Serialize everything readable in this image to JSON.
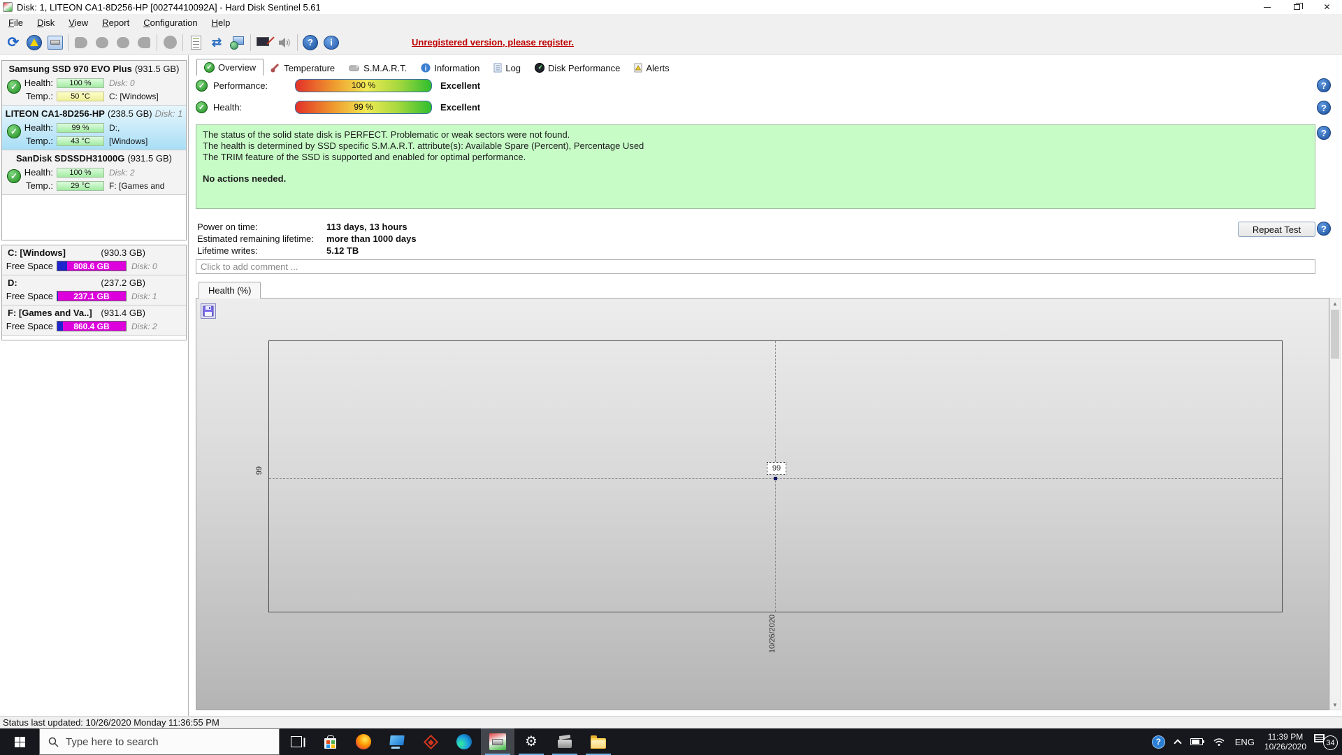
{
  "window": {
    "title": "Disk: 1, LITEON CA1-8D256-HP [00274410092A]  -  Hard Disk Sentinel 5.61"
  },
  "menu": [
    "File",
    "Disk",
    "View",
    "Report",
    "Configuration",
    "Help"
  ],
  "toolbar": {
    "register": "Unregistered version, please register."
  },
  "sidebar": {
    "disks": [
      {
        "name": "Samsung SSD 970 EVO Plus",
        "size": "(931.5 GB)",
        "extra": "",
        "health_label": "Health:",
        "health": "100 %",
        "health_right": "Disk: 0",
        "temp_label": "Temp.:",
        "temp": "50 °C",
        "temp_right": "C: [Windows]"
      },
      {
        "name": "LITEON CA1-8D256-HP",
        "size": "(238.5 GB)",
        "extra": "Disk: 1",
        "health_label": "Health:",
        "health": "99 %",
        "health_right": "D:,",
        "temp_label": "Temp.:",
        "temp": "43 °C",
        "temp_right": "[Windows]"
      },
      {
        "name": "SanDisk SDSSDH31000G",
        "size": "(931.5 GB)",
        "extra": "",
        "health_label": "Health:",
        "health": "100 %",
        "health_right": "Disk: 2",
        "temp_label": "Temp.:",
        "temp": "29 °C",
        "temp_right": "F: [Games and"
      }
    ],
    "partitions": [
      {
        "name": "C: [Windows]",
        "size": "(930.3 GB)",
        "free_label": "Free Space",
        "free": "808.6 GB",
        "right": "Disk: 0",
        "used_pct": "14%"
      },
      {
        "name": "D:",
        "size": "(237.2 GB)",
        "free_label": "Free Space",
        "free": "237.1 GB",
        "right": "Disk: 1",
        "used_pct": "1%"
      },
      {
        "name": "F: [Games and Va..]",
        "size": "(931.4 GB)",
        "free_label": "Free Space",
        "free": "860.4 GB",
        "right": "Disk: 2",
        "used_pct": "8%"
      }
    ]
  },
  "tabs": [
    "Overview",
    "Temperature",
    "S.M.A.R.T.",
    "Information",
    "Log",
    "Disk Performance",
    "Alerts"
  ],
  "overview": {
    "performance_label": "Performance:",
    "performance_value": "100 %",
    "performance_rating": "Excellent",
    "health_label": "Health:",
    "health_value": "99 %",
    "health_rating": "Excellent",
    "status_line1": "The status of the solid state disk is PERFECT. Problematic or weak sectors were not found.",
    "status_line2": "The health is determined by SSD specific S.M.A.R.T. attribute(s):  Available Spare (Percent), Percentage Used",
    "status_line3": "The TRIM feature of the SSD is supported and enabled for optimal performance.",
    "status_line4": "No actions needed.",
    "poweron_label": "Power on time:",
    "poweron_value": "113 days, 13 hours",
    "lifetime_label": "Estimated remaining lifetime:",
    "lifetime_value": "more than 1000 days",
    "writes_label": "Lifetime writes:",
    "writes_value": "5.12 TB",
    "repeat_test": "Repeat Test",
    "comment_placeholder": "Click to add comment ...",
    "help_glyph": "?"
  },
  "chart": {
    "tab": "Health (%)",
    "point_label": "99",
    "y_tick": "99",
    "x_tick": "10/26/2020"
  },
  "chart_data": {
    "type": "line",
    "title": "Health (%)",
    "x": [
      "10/26/2020"
    ],
    "series": [
      {
        "name": "Health",
        "values": [
          99
        ]
      }
    ],
    "ylabel": "Health (%)",
    "annotations": [
      "99"
    ],
    "grid": "dashed-crosshair",
    "legend": "none"
  },
  "statusbar": {
    "text": "Status last updated: 10/26/2020 Monday 11:36:55 PM"
  },
  "taskbar": {
    "search_placeholder": "Type here to search",
    "lang": "ENG",
    "time": "11:39 PM",
    "date": "10/26/2020",
    "notification_count": "34"
  }
}
